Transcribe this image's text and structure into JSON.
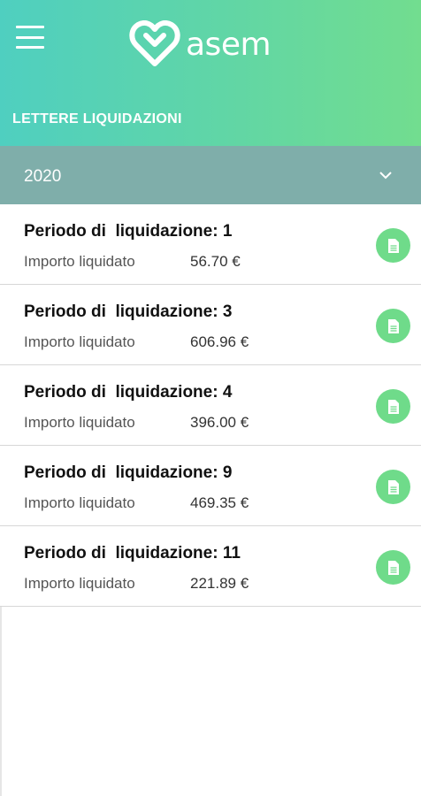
{
  "header": {
    "logo_text": "asem",
    "page_title": "LETTERE LIQUIDAZIONI",
    "menu_icon": "hamburger-menu-icon",
    "logo_icon": "heart-logo-icon",
    "gradient_start": "#4fcfc0",
    "gradient_end": "#72dd8f"
  },
  "year_selector": {
    "value": "2020",
    "icon": "chevron-down-icon",
    "color": "#7faeaa"
  },
  "items": [
    {
      "title": "Periodo di  liquidazione: 1",
      "label": "Importo liquidato",
      "amount": "56.70 €",
      "icon": "document-icon"
    },
    {
      "title": "Periodo di  liquidazione: 3",
      "label": "Importo liquidato",
      "amount": "606.96 €",
      "icon": "document-icon"
    },
    {
      "title": "Periodo di  liquidazione: 4",
      "label": "Importo liquidato",
      "amount": "396.00 €",
      "icon": "document-icon"
    },
    {
      "title": "Periodo di  liquidazione: 9",
      "label": "Importo liquidato",
      "amount": "469.35 €",
      "icon": "document-icon"
    },
    {
      "title": "Periodo di  liquidazione: 11",
      "label": "Importo liquidato",
      "amount": "221.89 €",
      "icon": "document-icon"
    }
  ],
  "colors": {
    "accent": "#6fdb8a"
  }
}
